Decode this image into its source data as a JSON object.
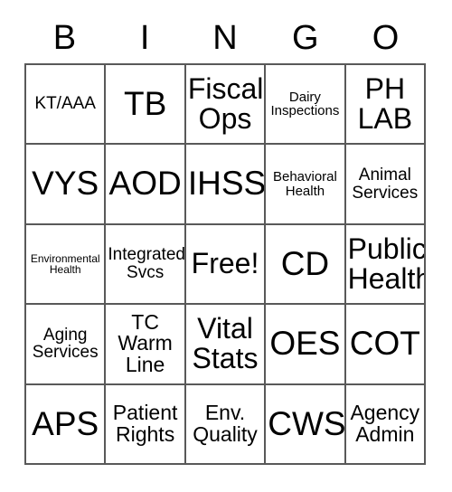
{
  "card": {
    "title": "BINGO",
    "header_letters": [
      "B",
      "I",
      "N",
      "G",
      "O"
    ],
    "free_space_label": "Free!",
    "colors": {
      "background": "#ffffff",
      "border": "#595959",
      "text": "#000000"
    },
    "rows": [
      [
        {
          "label": "KT/AAA",
          "size": "sm"
        },
        {
          "label": "TB",
          "size": "xl"
        },
        {
          "label": "Fiscal\nOps",
          "size": "lg"
        },
        {
          "label": "Dairy\nInspections",
          "size": "xs"
        },
        {
          "label": "PH\nLAB",
          "size": "lg"
        }
      ],
      [
        {
          "label": "VYS",
          "size": "xl"
        },
        {
          "label": "AOD",
          "size": "xl"
        },
        {
          "label": "IHSS",
          "size": "xl"
        },
        {
          "label": "Behavioral\nHealth",
          "size": "xs"
        },
        {
          "label": "Animal\nServices",
          "size": "sm"
        }
      ],
      [
        {
          "label": "Environmental\nHealth",
          "size": "xxs"
        },
        {
          "label": "Integrated\nSvcs",
          "size": "sm"
        },
        {
          "label": "Free!",
          "size": "lg"
        },
        {
          "label": "CD",
          "size": "xl"
        },
        {
          "label": "Public\nHealth",
          "size": "lg"
        }
      ],
      [
        {
          "label": "Aging\nServices",
          "size": "sm"
        },
        {
          "label": "TC\nWarm\nLine",
          "size": "md"
        },
        {
          "label": "Vital\nStats",
          "size": "lg"
        },
        {
          "label": "OES",
          "size": "xl"
        },
        {
          "label": "COT",
          "size": "xl"
        }
      ],
      [
        {
          "label": "APS",
          "size": "xl"
        },
        {
          "label": "Patient\nRights",
          "size": "md"
        },
        {
          "label": "Env.\nQuality",
          "size": "md"
        },
        {
          "label": "CWS",
          "size": "xl"
        },
        {
          "label": "Agency\nAdmin",
          "size": "md"
        }
      ]
    ]
  }
}
